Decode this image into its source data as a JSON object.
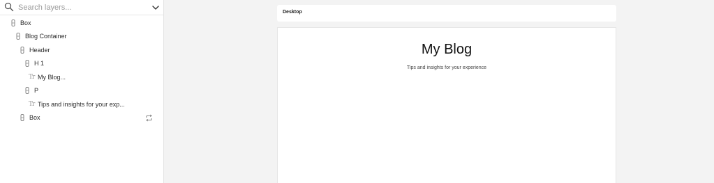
{
  "search": {
    "placeholder": "Search layers..."
  },
  "layers": [
    {
      "label": "Box",
      "type": "node"
    },
    {
      "label": "Blog Container",
      "type": "node"
    },
    {
      "label": "Header",
      "type": "node"
    },
    {
      "label": "H 1",
      "type": "node"
    },
    {
      "label": "My Blog...",
      "type": "text"
    },
    {
      "label": "P",
      "type": "node"
    },
    {
      "label": "Tips and insights for your exp...",
      "type": "text"
    },
    {
      "label": "Box",
      "type": "node",
      "badge_icon": "repeat-icon"
    }
  ],
  "text_icon_glyph": "Tr",
  "canvas": {
    "frame_title": "Desktop",
    "heading": "My Blog",
    "tagline": "Tips and insights for your experience"
  },
  "colors": {
    "panel_background": "#ffffff",
    "canvas_background": "#f3f3f3",
    "icon_gray": "#9a9a9a"
  }
}
